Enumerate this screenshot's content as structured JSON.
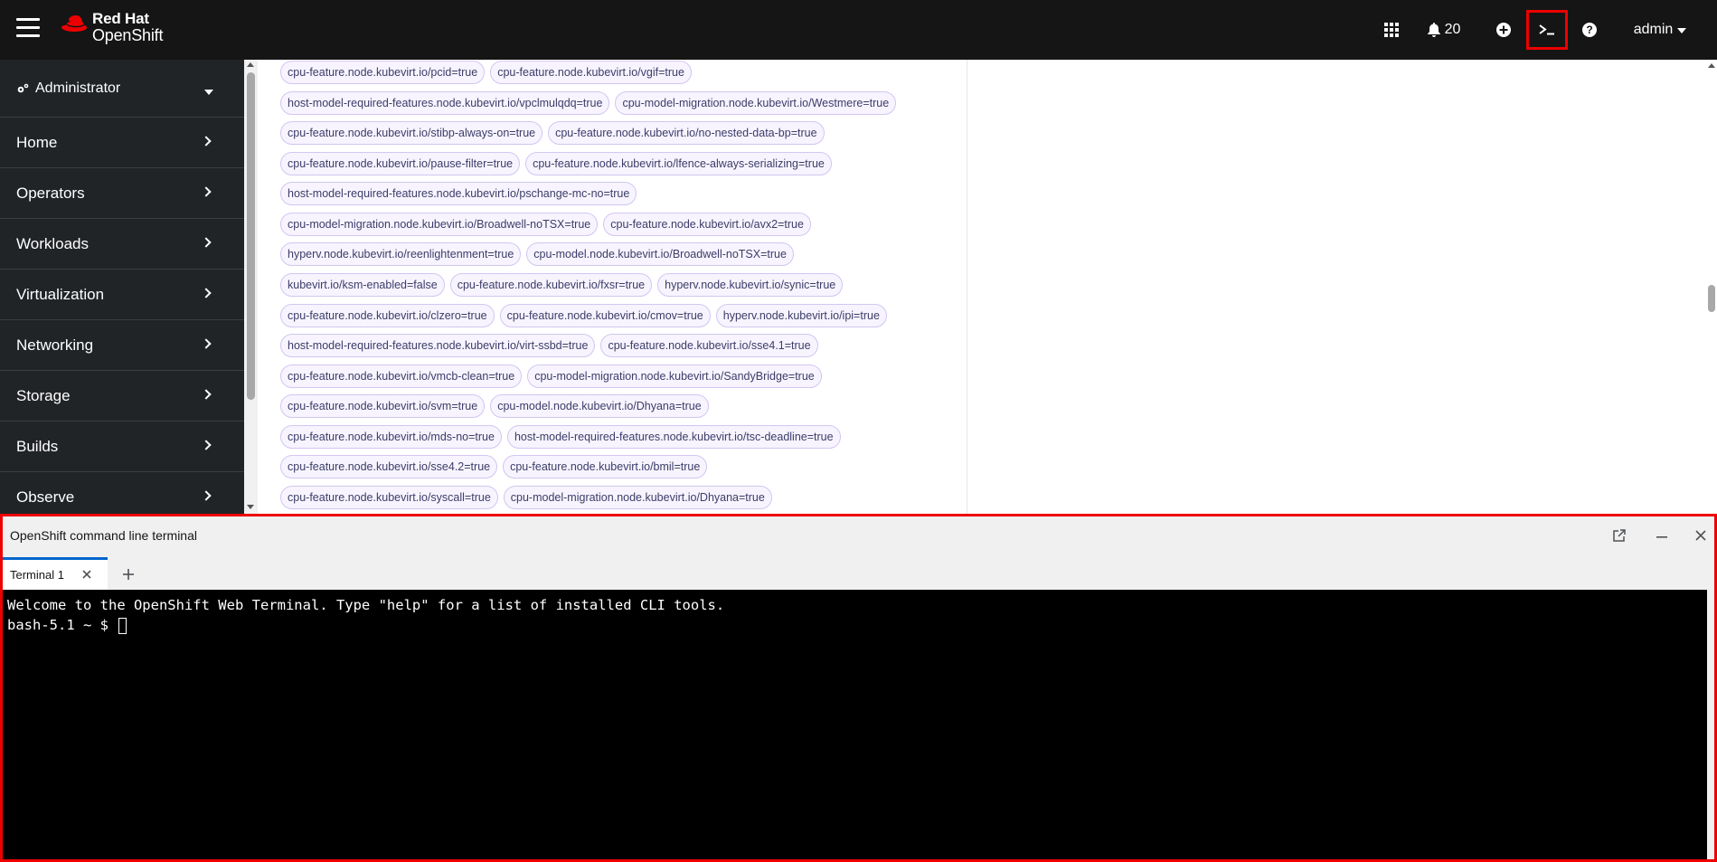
{
  "masthead": {
    "brand_line1": "Red Hat",
    "brand_line2": "OpenShift",
    "notification_count": "20",
    "user_label": "admin"
  },
  "sidebar": {
    "perspective": "Administrator",
    "items": [
      {
        "label": "Home"
      },
      {
        "label": "Operators"
      },
      {
        "label": "Workloads"
      },
      {
        "label": "Virtualization"
      },
      {
        "label": "Networking"
      },
      {
        "label": "Storage"
      },
      {
        "label": "Builds"
      },
      {
        "label": "Observe"
      }
    ]
  },
  "labels": {
    "rows": [
      [
        "cpu-feature.node.kubevirt.io/pcid=true",
        "cpu-feature.node.kubevirt.io/vgif=true"
      ],
      [
        "host-model-required-features.node.kubevirt.io/vpclmulqdq=true",
        "cpu-model-migration.node.kubevirt.io/Westmere=true"
      ],
      [
        "cpu-feature.node.kubevirt.io/stibp-always-on=true",
        "cpu-feature.node.kubevirt.io/no-nested-data-bp=true"
      ],
      [
        "cpu-feature.node.kubevirt.io/pause-filter=true",
        "cpu-feature.node.kubevirt.io/lfence-always-serializing=true"
      ],
      [
        "host-model-required-features.node.kubevirt.io/pschange-mc-no=true"
      ],
      [
        "cpu-model-migration.node.kubevirt.io/Broadwell-noTSX=true",
        "cpu-feature.node.kubevirt.io/avx2=true"
      ],
      [
        "hyperv.node.kubevirt.io/reenlightenment=true",
        "cpu-model.node.kubevirt.io/Broadwell-noTSX=true"
      ],
      [
        "kubevirt.io/ksm-enabled=false",
        "cpu-feature.node.kubevirt.io/fxsr=true",
        "hyperv.node.kubevirt.io/synic=true"
      ],
      [
        "cpu-feature.node.kubevirt.io/clzero=true",
        "cpu-feature.node.kubevirt.io/cmov=true",
        "hyperv.node.kubevirt.io/ipi=true"
      ],
      [
        "host-model-required-features.node.kubevirt.io/virt-ssbd=true",
        "cpu-feature.node.kubevirt.io/sse4.1=true"
      ],
      [
        "cpu-feature.node.kubevirt.io/vmcb-clean=true",
        "cpu-model-migration.node.kubevirt.io/SandyBridge=true"
      ],
      [
        "cpu-feature.node.kubevirt.io/svm=true",
        "cpu-model.node.kubevirt.io/Dhyana=true"
      ],
      [
        "cpu-feature.node.kubevirt.io/mds-no=true",
        "host-model-required-features.node.kubevirt.io/tsc-deadline=true"
      ],
      [
        "cpu-feature.node.kubevirt.io/sse4.2=true",
        "cpu-feature.node.kubevirt.io/bmil=true"
      ],
      [
        "cpu-feature.node.kubevirt.io/syscall=true",
        "cpu-model-migration.node.kubevirt.io/Dhyana=true"
      ]
    ]
  },
  "terminal_drawer": {
    "title": "OpenShift command line terminal",
    "tabs": [
      {
        "label": "Terminal 1"
      }
    ],
    "lines": [
      "Welcome to the OpenShift Web Terminal. Type \"help\" for a list of installed CLI tools.",
      "bash-5.1 ~ $ "
    ]
  },
  "colors": {
    "masthead_bg": "#151515",
    "sidebar_bg": "#212427",
    "highlight": "#ee0000",
    "tab_accent": "#0066cc"
  }
}
